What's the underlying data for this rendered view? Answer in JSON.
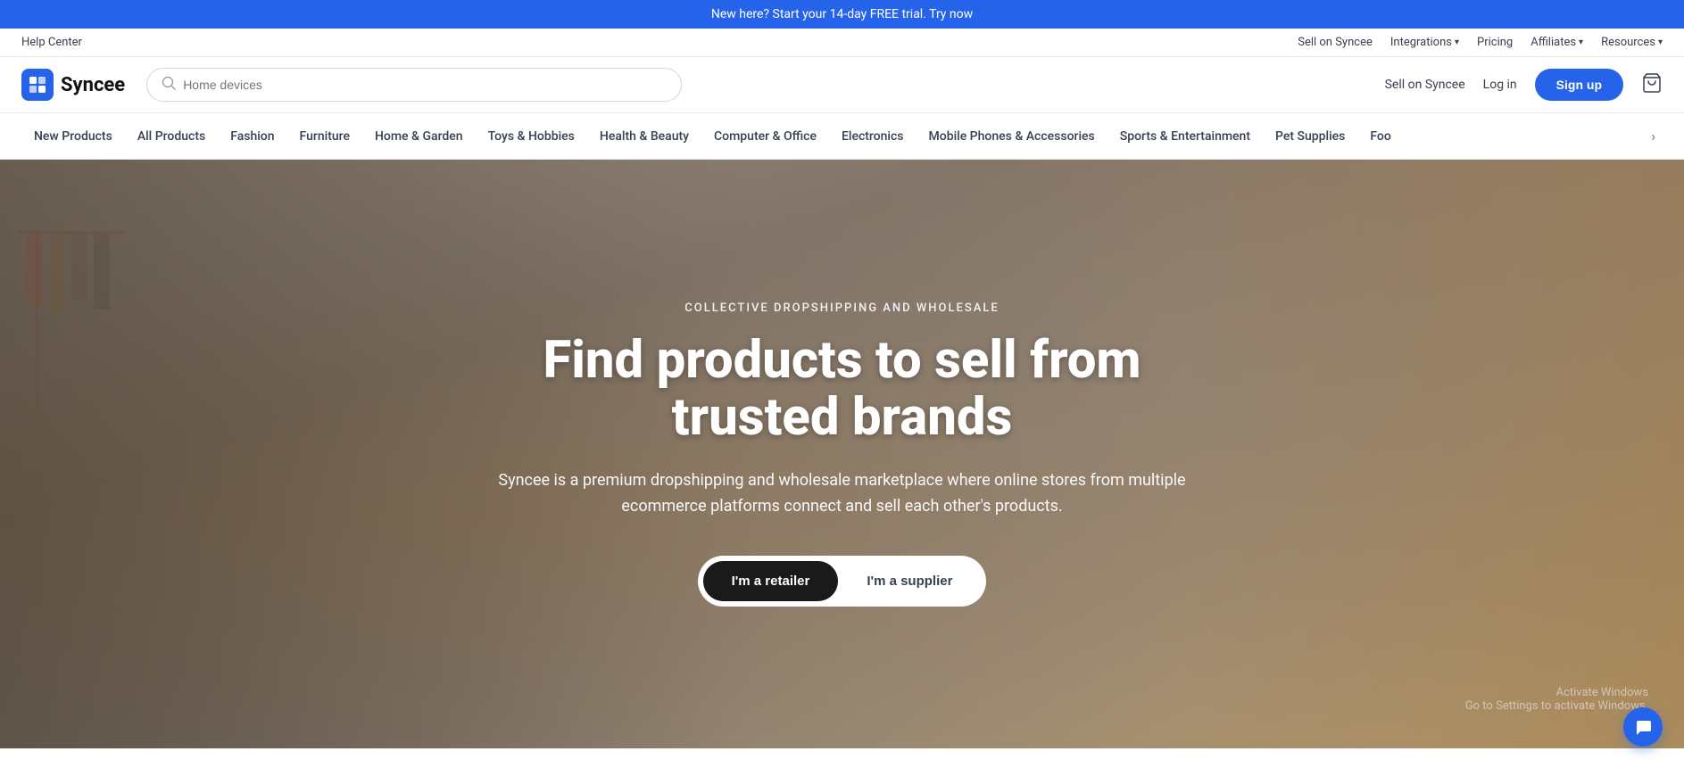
{
  "topBanner": {
    "text": "New here? Start your 14-day FREE trial. Try now",
    "link_text": "Try now"
  },
  "utilityBar": {
    "help_link": "Help Center",
    "right_items": [
      {
        "label": "Sell on Syncee",
        "has_arrow": false
      },
      {
        "label": "Integrations",
        "has_arrow": true
      },
      {
        "label": "Pricing",
        "has_arrow": false
      },
      {
        "label": "Affiliates",
        "has_arrow": true
      },
      {
        "label": "Resources",
        "has_arrow": true
      }
    ]
  },
  "header": {
    "logo_text": "Syncee",
    "search_placeholder": "Home devices",
    "sell_link": "Sell on Syncee",
    "login_link": "Log in",
    "signup_label": "Sign up"
  },
  "nav": {
    "items": [
      {
        "label": "New Products"
      },
      {
        "label": "All Products"
      },
      {
        "label": "Fashion"
      },
      {
        "label": "Furniture"
      },
      {
        "label": "Home & Garden"
      },
      {
        "label": "Toys & Hobbies"
      },
      {
        "label": "Health & Beauty"
      },
      {
        "label": "Computer & Office"
      },
      {
        "label": "Electronics"
      },
      {
        "label": "Mobile Phones & Accessories"
      },
      {
        "label": "Sports & Entertainment"
      },
      {
        "label": "Pet Supplies"
      },
      {
        "label": "Foo"
      }
    ]
  },
  "hero": {
    "subtitle": "COLLECTIVE DROPSHIPPING AND WHOLESALE",
    "title": "Find products to sell from trusted brands",
    "description": "Syncee is a premium dropshipping and wholesale marketplace where online stores from multiple ecommerce platforms connect and sell each other's products.",
    "btn_retailer": "I'm a retailer",
    "btn_supplier": "I'm a supplier"
  },
  "windows": {
    "line1": "Activate Windows",
    "line2": "Go to Settings to activate Windows."
  },
  "icons": {
    "search": "🔍",
    "cart": "🛒",
    "chat": "💬",
    "logo_symbol": "S",
    "chevron": "▾",
    "arrow_right": "›"
  },
  "colors": {
    "primary": "#2563eb",
    "dark": "#1a1a1a",
    "text": "#374151",
    "light_text": "#6b7280"
  }
}
